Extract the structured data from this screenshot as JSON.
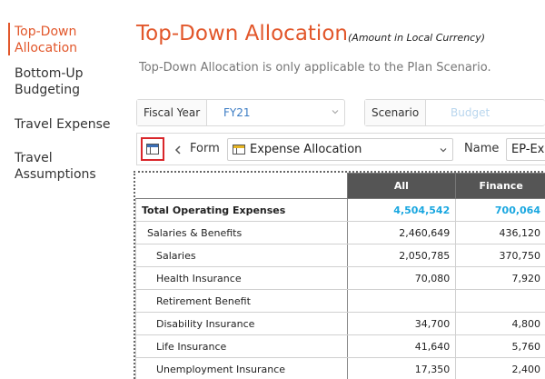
{
  "sidebar": {
    "items": [
      {
        "label": "Top-Down\nAllocation",
        "active": true
      },
      {
        "label": "Bottom-Up\nBudgeting",
        "active": false
      },
      {
        "label": "Travel Expense",
        "active": false
      },
      {
        "label": "Travel\nAssumptions",
        "active": false
      }
    ]
  },
  "header": {
    "title": "Top-Down Allocation",
    "subtitle": "(Amount in Local Currency)",
    "note": "Top-Down Allocation is only applicable to the Plan Scenario."
  },
  "filters": {
    "fiscal_year": {
      "label": "Fiscal Year",
      "value": "FY21"
    },
    "scenario": {
      "label": "Scenario",
      "placeholder": "Budget"
    }
  },
  "toolbar": {
    "form_label": "Form",
    "form_value": "Expense Allocation",
    "name_label": "Name",
    "name_value": "EP-Exp"
  },
  "grid": {
    "columns": [
      "",
      "All",
      "Finance"
    ],
    "rows": [
      {
        "label": "Total Operating Expenses",
        "all": "4,504,542",
        "finance": "700,064",
        "type": "total"
      },
      {
        "label": "Salaries & Benefits",
        "all": "2,460,649",
        "finance": "436,120",
        "type": "lvl1"
      },
      {
        "label": "Salaries",
        "all": "2,050,785",
        "finance": "370,750",
        "type": "lvl2"
      },
      {
        "label": "Health Insurance",
        "all": "70,080",
        "finance": "7,920",
        "type": "lvl2"
      },
      {
        "label": "Retirement Benefit",
        "all": "",
        "finance": "",
        "type": "lvl2"
      },
      {
        "label": "Disability  Insurance",
        "all": "34,700",
        "finance": "4,800",
        "type": "lvl2"
      },
      {
        "label": "Life Insurance",
        "all": "41,640",
        "finance": "5,760",
        "type": "lvl2"
      },
      {
        "label": "Unemployment Insurance",
        "all": "17,350",
        "finance": "2,400",
        "type": "lvl2"
      }
    ]
  },
  "colors": {
    "accent": "#e2572b",
    "total_value": "#1aa7e0",
    "header_bg": "#555555",
    "highlight_border": "#d9262a",
    "fy_value": "#3b7cc4",
    "placeholder": "#b9d6ee"
  },
  "icons": [
    "layout-icon",
    "chevron-left-icon",
    "form-icon",
    "chevron-down-icon"
  ]
}
